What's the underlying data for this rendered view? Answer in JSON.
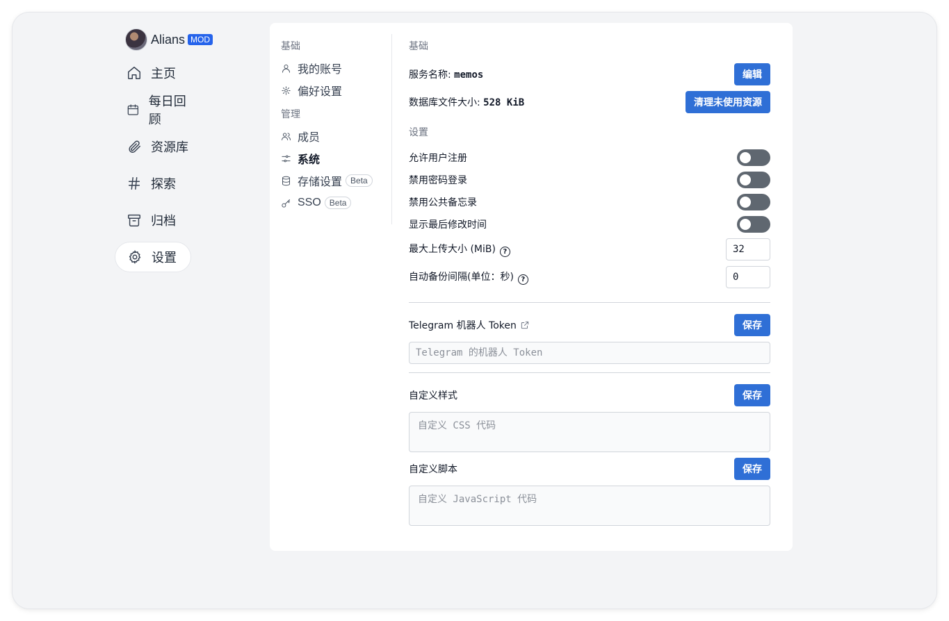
{
  "nav": {
    "profile": {
      "name": "Alians",
      "badge": "MOD"
    },
    "items": [
      {
        "label": "主页",
        "icon": "home-icon"
      },
      {
        "label": "每日回顾",
        "icon": "calendar-icon"
      },
      {
        "label": "资源库",
        "icon": "paperclip-icon"
      },
      {
        "label": "探索",
        "icon": "hash-icon"
      },
      {
        "label": "归档",
        "icon": "archive-icon"
      },
      {
        "label": "设置",
        "icon": "gear-icon",
        "active": true
      }
    ]
  },
  "subnav": {
    "basic_heading": "基础",
    "account": "我的账号",
    "preferences": "偏好设置",
    "admin_heading": "管理",
    "members": "成员",
    "system": "系统",
    "storage": "存储设置",
    "storage_badge": "Beta",
    "sso": "SSO",
    "sso_badge": "Beta"
  },
  "main": {
    "basic_heading": "基础",
    "server_name_label": "服务名称: ",
    "server_name_value": "memos",
    "edit_button": "编辑",
    "db_size_label": "数据库文件大小: ",
    "db_size_value": "528 KiB",
    "vacuum_button": "清理未使用资源",
    "settings_heading": "设置",
    "toggles": [
      {
        "label": "允许用户注册",
        "on": false
      },
      {
        "label": "禁用密码登录",
        "on": false
      },
      {
        "label": "禁用公共备忘录",
        "on": false
      },
      {
        "label": "显示最后修改时间",
        "on": false
      }
    ],
    "max_upload_label": "最大上传大小 (MiB)",
    "max_upload_value": "32",
    "backup_interval_label": "自动备份间隔(单位：秒)",
    "backup_interval_value": "0",
    "telegram_label": "Telegram 机器人 Token",
    "telegram_placeholder": "Telegram 的机器人 Token",
    "save_label": "保存",
    "custom_style_label": "自定义样式",
    "custom_style_placeholder": "自定义 CSS 代码",
    "custom_script_label": "自定义脚本",
    "custom_script_placeholder": "自定义 JavaScript 代码"
  }
}
